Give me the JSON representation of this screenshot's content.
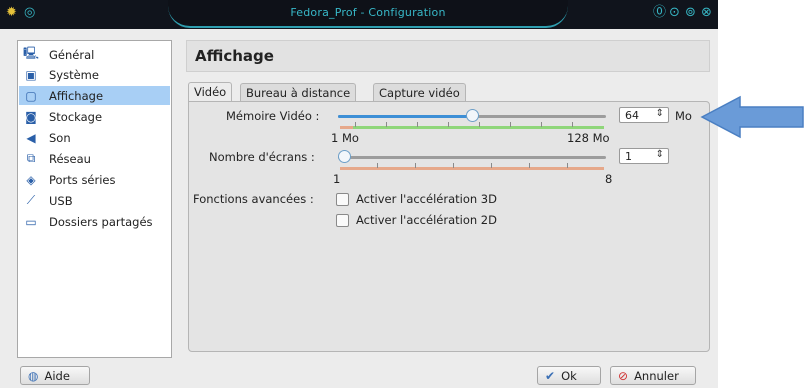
{
  "window": {
    "title": "Fedora_Prof - Configuration"
  },
  "titlebar_icons": [
    "app-icon",
    "menu-icon",
    "help-icon",
    "minimize-icon",
    "maximize-icon",
    "close-icon"
  ],
  "sidebar": {
    "items": [
      {
        "label": "Général",
        "icon": "monitor-icon",
        "selected": false
      },
      {
        "label": "Système",
        "icon": "chip-icon",
        "selected": false
      },
      {
        "label": "Affichage",
        "icon": "display-icon",
        "selected": true
      },
      {
        "label": "Stockage",
        "icon": "disk-icon",
        "selected": false
      },
      {
        "label": "Son",
        "icon": "speaker-icon",
        "selected": false
      },
      {
        "label": "Réseau",
        "icon": "network-icon",
        "selected": false
      },
      {
        "label": "Ports séries",
        "icon": "serial-port-icon",
        "selected": false
      },
      {
        "label": "USB",
        "icon": "usb-icon",
        "selected": false
      },
      {
        "label": "Dossiers partagés",
        "icon": "folder-icon",
        "selected": false
      }
    ]
  },
  "main": {
    "title": "Affichage",
    "tabs": [
      {
        "label": "Vidéo",
        "active": true
      },
      {
        "label": "Bureau à distance",
        "active": false
      },
      {
        "label": "Capture vidéo",
        "active": false
      }
    ],
    "video_memory": {
      "label": "Mémoire Vidéo :",
      "value": "64",
      "unit": "Mo",
      "min_label": "1 Mo",
      "max_label": "128 Mo",
      "level": 0.5
    },
    "screens": {
      "label": "Nombre d'écrans :",
      "value": "1",
      "min_label": "1",
      "max_label": "8",
      "level": 0.0
    },
    "advanced": {
      "label": "Fonctions avancées :",
      "accel_3d": {
        "label": "Activer l'accélération 3D",
        "checked": false
      },
      "accel_2d": {
        "label": "Activer l'accélération 2D",
        "checked": false
      }
    }
  },
  "footer": {
    "help": "Aide",
    "ok": "Ok",
    "cancel": "Annuler"
  },
  "colors": {
    "accent": "#38b8c8",
    "selection": "#a8cff5",
    "safe_zone": "#8fd67a",
    "warn_zone": "#e6a88a",
    "annotation_arrow": "#6a9bd8"
  }
}
